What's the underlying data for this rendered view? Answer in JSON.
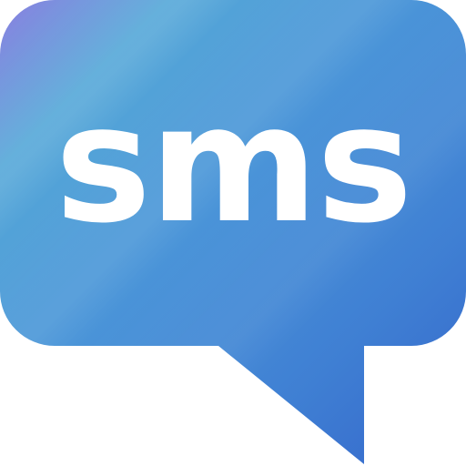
{
  "icon": {
    "name": "sms-chat-bubble-icon",
    "label": "sms",
    "colors": {
      "gradient_start": "#8a7fe0",
      "gradient_mid": "#4c9ad6",
      "gradient_end": "#3a6fd0",
      "text": "#ffffff",
      "background": "#ffffff"
    }
  }
}
